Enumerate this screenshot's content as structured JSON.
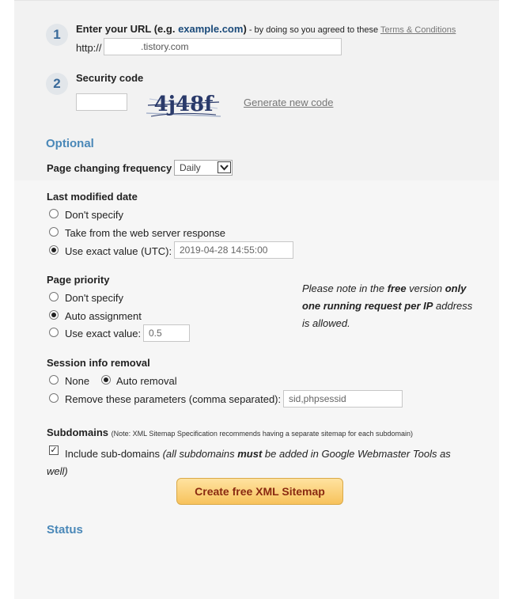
{
  "step1": {
    "number": "1",
    "label_prefix": "Enter your URL (e.g. ",
    "example": "example.com",
    "label_suffix": ")",
    "agree_text": " - by doing so you agreed to these ",
    "terms_link": "Terms & Conditions",
    "protocol": "http://",
    "url_value": ".tistory.com"
  },
  "step2": {
    "number": "2",
    "label": "Security code",
    "captcha_text": "4j48f",
    "generate_link": "Generate new code"
  },
  "optional": {
    "heading": "Optional",
    "frequency_label": "Page changing frequency",
    "frequency_value": "Daily"
  },
  "last_modified": {
    "heading": "Last modified date",
    "options": [
      "Don't specify",
      "Take from the web server response",
      "Use exact value (UTC):"
    ],
    "selected_index": 2,
    "exact_value": "2019-04-28 14:55:00"
  },
  "priority": {
    "heading": "Page priority",
    "options": [
      "Don't specify",
      "Auto assignment",
      "Use exact value:"
    ],
    "selected_index": 1,
    "exact_value": "0.5"
  },
  "note": {
    "part1": "Please note in the ",
    "part2": "free",
    "part3": " version ",
    "part4": "only one running request per IP",
    "part5": " address is allowed."
  },
  "session": {
    "heading": "Session info removal",
    "options": [
      "None",
      "Auto removal",
      "Remove these parameters (comma separated):"
    ],
    "selected_index": 1,
    "params_value": "sid,phpsessid"
  },
  "subdomains": {
    "heading": "Subdomains",
    "note": "(Note: XML Sitemap Specification recommends having a separate sitemap for each subdomain)",
    "checked": true,
    "include_label": "Include sub-domains",
    "include_note_a": "(all subdomains ",
    "include_note_b": "must",
    "include_note_c": " be added in Google Webmaster Tools as well)"
  },
  "create_button": "Create free XML Sitemap",
  "status_heading": "Status"
}
